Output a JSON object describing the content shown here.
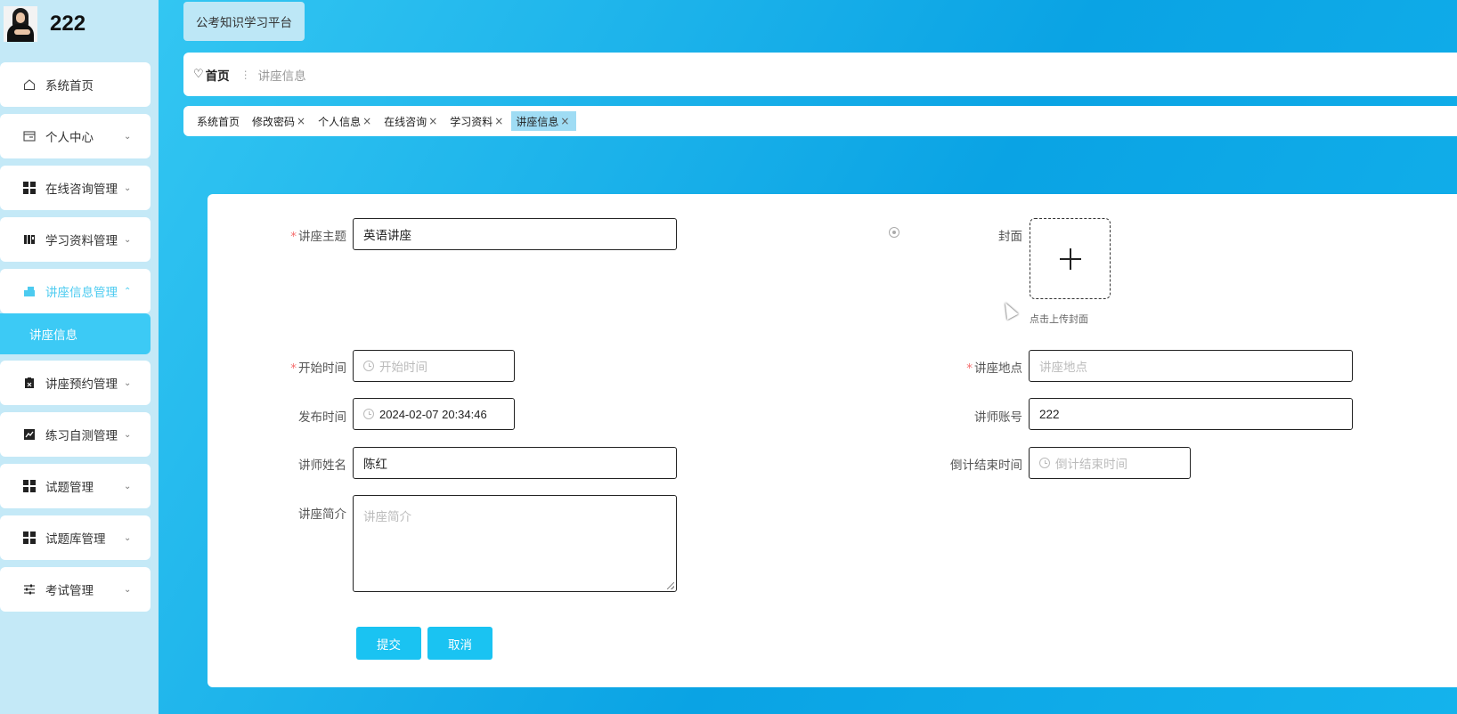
{
  "sidebar": {
    "username": "222",
    "items": [
      {
        "label": "系统首页",
        "icon": "home-icon"
      },
      {
        "label": "个人中心",
        "icon": "card-icon"
      },
      {
        "label": "在线咨询管理",
        "icon": "grid-icon"
      },
      {
        "label": "学习资料管理",
        "icon": "book-icon"
      },
      {
        "label": "讲座信息管理",
        "icon": "lecture-icon"
      },
      {
        "label": "讲座预约管理",
        "icon": "clipboard-icon"
      },
      {
        "label": "练习自测管理",
        "icon": "chart-icon"
      },
      {
        "label": "试题管理",
        "icon": "grid-icon"
      },
      {
        "label": "试题库管理",
        "icon": "grid-icon"
      },
      {
        "label": "考试管理",
        "icon": "sliders-icon"
      }
    ],
    "submenu": {
      "label": "讲座信息"
    }
  },
  "header": {
    "platform_title": "公考知识学习平台"
  },
  "breadcrumb": {
    "home": "首页",
    "current": "讲座信息"
  },
  "tags": [
    {
      "label": "系统首页",
      "closable": false
    },
    {
      "label": "修改密码",
      "closable": true
    },
    {
      "label": "个人信息",
      "closable": true
    },
    {
      "label": "在线咨询",
      "closable": true
    },
    {
      "label": "学习资料",
      "closable": true
    },
    {
      "label": "讲座信息",
      "closable": true,
      "active": true
    }
  ],
  "form": {
    "topic": {
      "label": "讲座主题",
      "value": "英语讲座"
    },
    "cover": {
      "label": "封面",
      "tip": "点击上传封面"
    },
    "start_time": {
      "label": "开始时间",
      "placeholder": "开始时间"
    },
    "location": {
      "label": "讲座地点",
      "placeholder": "讲座地点"
    },
    "publish_time": {
      "label": "发布时间",
      "value": "2024-02-07 20:34:46"
    },
    "teacher_account": {
      "label": "讲师账号",
      "value": "222"
    },
    "teacher_name": {
      "label": "讲师姓名",
      "value": "陈红"
    },
    "countdown_end": {
      "label": "倒计结束时间",
      "placeholder": "倒计结束时间"
    },
    "intro": {
      "label": "讲座简介",
      "placeholder": "讲座简介"
    },
    "submit_label": "提交",
    "cancel_label": "取消"
  },
  "colors": {
    "accent": "#1ac3f2",
    "active_menu_text": "#4ccbf0",
    "required": "#f56c6c"
  }
}
